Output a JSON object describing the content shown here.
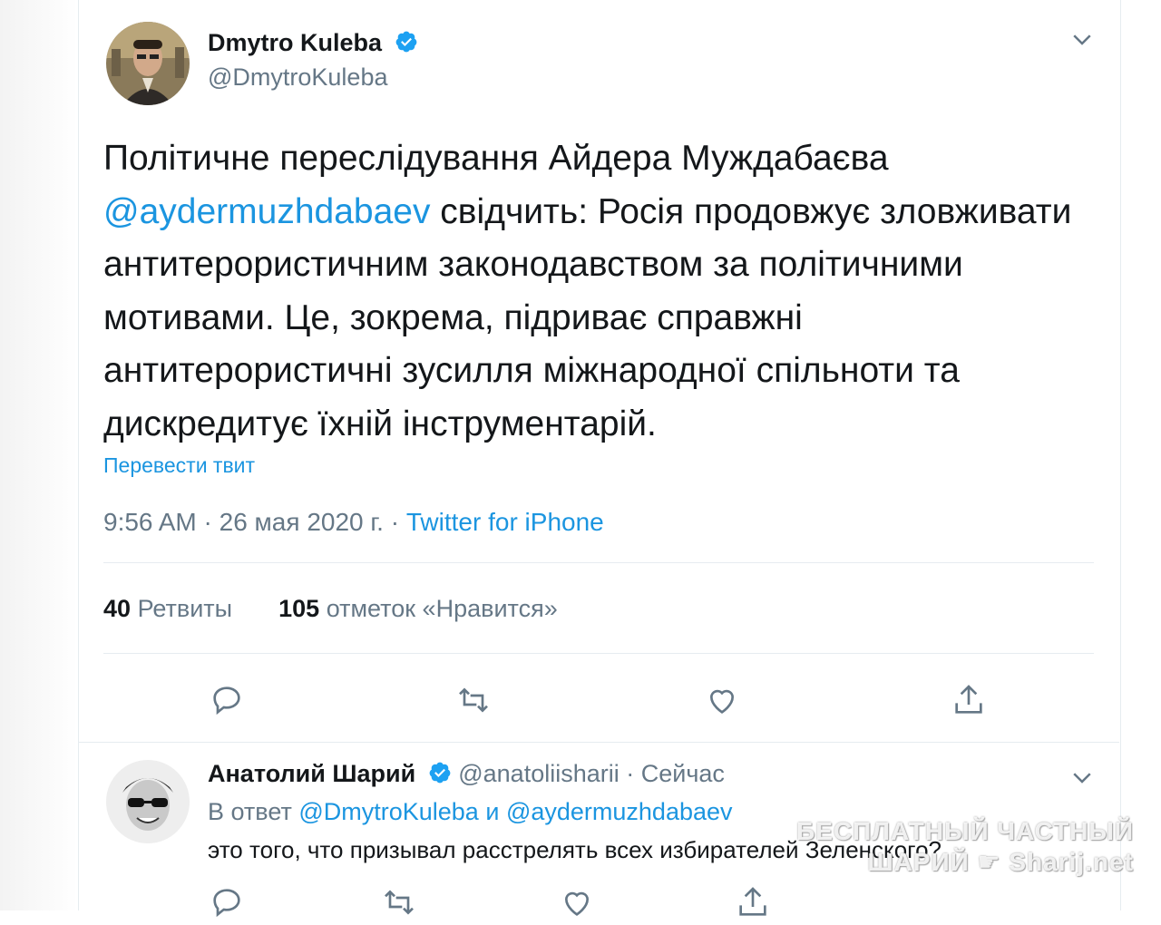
{
  "tweet": {
    "author_name": "Dmytro Kuleba",
    "author_handle": "@DmytroKuleba",
    "text_line1": "Політичне переслідування Айдера Муждабаєва",
    "mention": "@aydermuzhdabaev",
    "text_after_mention": " свідчить: Росія продовжує зловживати антитерористичним законодавством за політичними мотивами. Це, зокрема, підриває справжні антитерористичні зусилля міжнародної спільноти та дискредитує їхній інструментарій.",
    "translate_label": "Перевести твит",
    "time": "9:56 AM",
    "date": "26 мая 2020 г.",
    "source": "Twitter for iPhone",
    "retweets_count": "40",
    "retweets_label": "Ретвиты",
    "likes_count": "105",
    "likes_label": "отметок «Нравится»"
  },
  "reply": {
    "author_name": "Анатолий Шарий",
    "author_handle": "@anatoliisharii",
    "time": "Сейчас",
    "reply_prefix": "В ответ",
    "reply_user1": "@DmytroKuleba",
    "reply_and": "и",
    "reply_user2": "@aydermuzhdabaev",
    "text": "это того, что призывал расстрелять всех избирателей Зеленского?"
  },
  "watermark": {
    "line1": "БЕСПЛАТНЫЙ ЧАСТНЫЙ",
    "line2": "ШАРИЙ",
    "line3": "Sharij.net"
  },
  "icons": [
    "verified-badge-icon",
    "chevron-down-icon",
    "reply-icon",
    "retweet-icon",
    "like-icon",
    "share-icon"
  ],
  "colors": {
    "accent": "#1b95e0",
    "secondary_text": "#657786",
    "divider": "#e6ecf0"
  }
}
